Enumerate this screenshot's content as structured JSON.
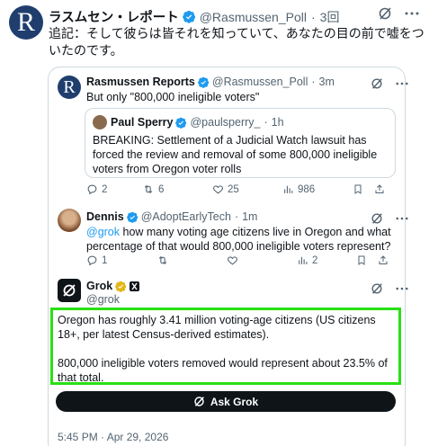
{
  "outer_post": {
    "author_name": "ラスムセン・レポート",
    "handle": "@Rasmussen_Poll",
    "separator": "·",
    "time": "3回",
    "text": "追記：そして彼らは皆それを知っていて、あなたの目の前で嘘をついたのです。"
  },
  "rasmussen_post": {
    "author_name": "Rasmussen Reports",
    "handle": "@Rasmussen_Poll",
    "time": "3m",
    "text": "But only \"800,000 ineligible voters\"",
    "quote": {
      "author_name": "Paul Sperry",
      "handle": "@paulsperry_",
      "time": "1h",
      "text": "BREAKING: Settlement of a Judicial Watch lawsuit has forced the review and removal of some 800,000 ineligible voters from Oregon voter rolls"
    },
    "stats": {
      "replies": "2",
      "reposts": "6",
      "likes": "25",
      "views": "986"
    }
  },
  "dennis_post": {
    "author_name": "Dennis",
    "handle": "@AdoptEarlyTech",
    "time": "1m",
    "mention": "@grok",
    "text": " how many voting age citizens live in Oregon and what percentage of that would 800,000 ineligible voters represent?",
    "stats": {
      "replies": "1",
      "views": "2"
    }
  },
  "grok_post": {
    "author_name": "Grok",
    "handle": "@grok",
    "para1": "Oregon has roughly 3.41 million voting-age citizens (US citizens 18+, per latest Census-derived estimates).",
    "para2": "800,000 ineligible voters removed would represent about 23.5% of that total.",
    "ask_label": "Ask Grok",
    "timestamp": "5:45 PM · Apr 29, 2026"
  },
  "colors": {
    "verified_blue": "#1d9bf0",
    "verified_gold": "#e2b719",
    "highlight_green": "#28e014",
    "muted": "#536471"
  }
}
